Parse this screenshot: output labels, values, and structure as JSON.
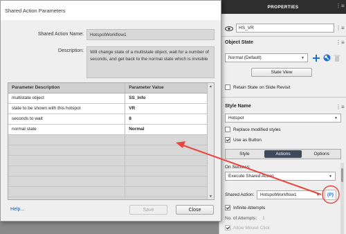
{
  "dialog": {
    "title": "Shared Action Parameters",
    "name_label": "Shared Action Name:",
    "name_value": "HotspotWorkflow1",
    "description_label": "Description:",
    "description_value": "Will change state of a multistate object, wait for a number of seconds, and get back to the normal state which is invisible",
    "columns": [
      "Parameter Description",
      "Parameter Value"
    ],
    "rows": [
      {
        "description": "multistate object",
        "value": "SS_Info"
      },
      {
        "description": "state to be shown with this hotspot",
        "value": "VR"
      },
      {
        "description": "seconds to wait",
        "value": "8"
      },
      {
        "description": "normal state",
        "value": "Normal"
      }
    ],
    "help_link": "Help...",
    "save_label": "Save",
    "close_label": "Close"
  },
  "properties": {
    "title": "PROPERTIES",
    "name_value": "HS_VR",
    "object_state_title": "Object State",
    "state_value": "Normal (Default)",
    "state_view_label": "State View",
    "retain_state_label": "Retain State on Slide Revisit",
    "style_name_title": "Style Name",
    "style_value": "Hotspot",
    "replace_styles_label": "Replace modified styles",
    "use_as_button_label": "Use as Button",
    "tabs": [
      "Style",
      "Actions",
      "Options"
    ],
    "active_tab": "Actions",
    "on_success_label": "On Success:",
    "on_success_value": "Execute Shared Action",
    "shared_action_label": "Shared Action:",
    "shared_action_value": "HotspotWorkflow1",
    "param_button_label": "{P}",
    "infinite_attempts_label": "Infinite Attempts",
    "attempts_label": "No. of Attempts:",
    "attempts_value": "1",
    "allow_mouse_click_label": "Allow Mouse Click"
  },
  "colors": {
    "accent_blue": "#1f6fd1",
    "annotation_red": "#e8453c",
    "active_tab": "#3d4a5c"
  }
}
